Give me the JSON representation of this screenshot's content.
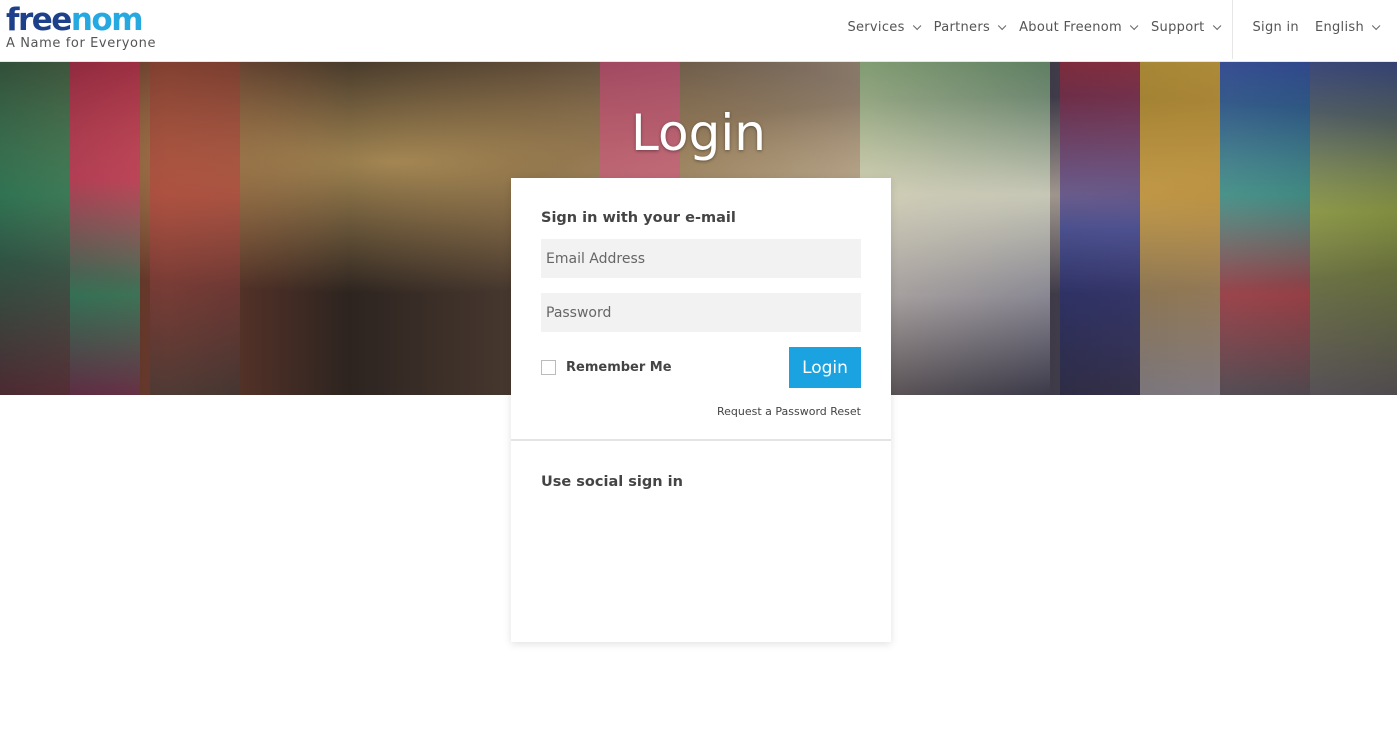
{
  "brand": {
    "logo_part1": "free",
    "logo_part2": "nom",
    "tagline": "A Name for Everyone"
  },
  "nav": {
    "items": [
      {
        "label": "Services"
      },
      {
        "label": "Partners"
      },
      {
        "label": "About Freenom"
      },
      {
        "label": "Support"
      }
    ],
    "sign_in": "Sign in",
    "language": "English"
  },
  "hero": {
    "title": "Login"
  },
  "login": {
    "heading": "Sign in with your e-mail",
    "email_placeholder": "Email Address",
    "email_value": "",
    "password_placeholder": "Password",
    "password_value": "",
    "remember_label": "Remember Me",
    "remember_checked": false,
    "button_label": "Login",
    "reset_link": "Request a Password Reset",
    "accent_color": "#1aa3e0"
  },
  "social": {
    "heading": "Use social sign in"
  }
}
